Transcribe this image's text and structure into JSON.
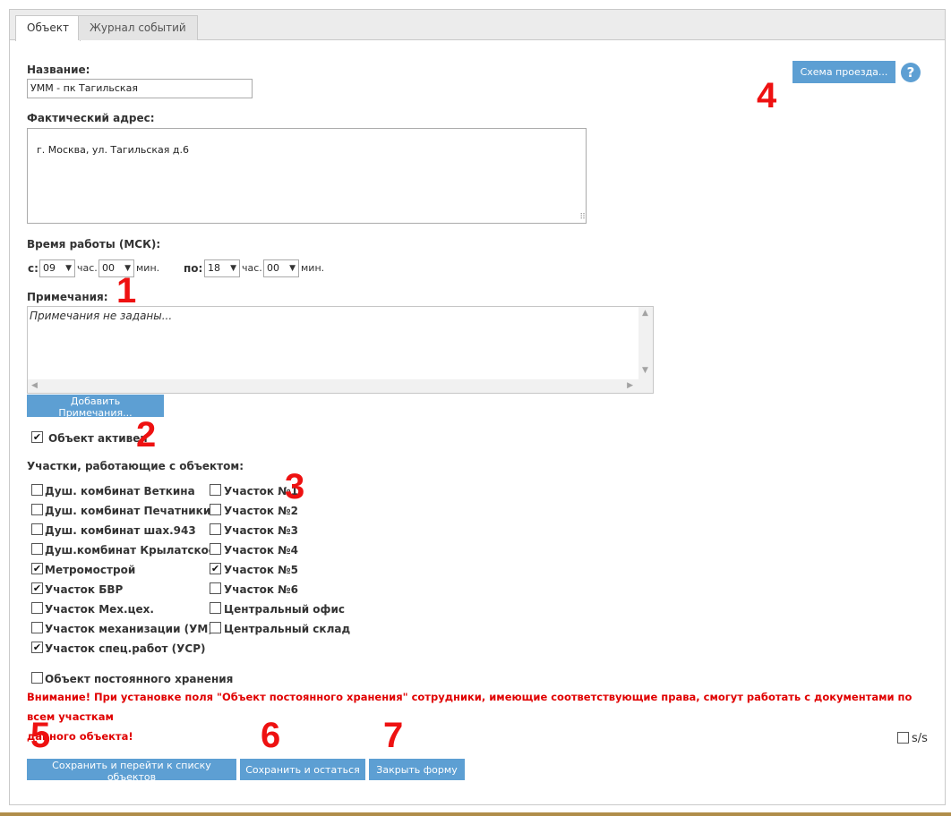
{
  "tabs": [
    {
      "label": "Объект",
      "active": true
    },
    {
      "label": "Журнал событий",
      "active": false
    }
  ],
  "form": {
    "name_label": "Название:",
    "name_value": "УММ - пк Тагильская",
    "address_label": "Фактический адрес:",
    "address_value": "г. Москва, ул. Тагильская д.6",
    "route_button": "Схема проезда...",
    "help_icon": "?",
    "work_time_label": "Время работы (МСК):",
    "from_label": "с:",
    "to_label": "по:",
    "from_hour": "09",
    "from_min": "00",
    "to_hour": "18",
    "to_min": "00",
    "hour_unit": "час.",
    "min_unit": "мин.",
    "notes_label": "Примечания:",
    "notes_placeholder": "Примечания не заданы...",
    "add_notes_button": "Добавить Примечания...",
    "active_label": "Объект активен",
    "active_checked": true,
    "sites_label": "Участки, работающие с объектом:",
    "sites_col1": [
      {
        "label": "Душ. комбинат Веткина",
        "checked": false
      },
      {
        "label": "Душ. комбинат Печатники",
        "checked": false
      },
      {
        "label": "Душ. комбинат шах.943",
        "checked": false
      },
      {
        "label": "Душ.комбинат Крылатское",
        "checked": false
      },
      {
        "label": "Метромострой",
        "checked": true
      },
      {
        "label": "Участок БВР",
        "checked": true
      },
      {
        "label": "Участок Мех.цех.",
        "checked": false
      },
      {
        "label": "Участок механизации (УМ)",
        "checked": false
      },
      {
        "label": "Участок спец.работ (УСР)",
        "checked": true
      }
    ],
    "sites_col2": [
      {
        "label": "Участок №1",
        "checked": false
      },
      {
        "label": "Участок №2",
        "checked": false
      },
      {
        "label": "Участок №3",
        "checked": false
      },
      {
        "label": "Участок №4",
        "checked": false
      },
      {
        "label": "Участок №5",
        "checked": true
      },
      {
        "label": "Участок №6",
        "checked": false
      },
      {
        "label": "Центральный офис",
        "checked": false
      },
      {
        "label": "Центральный склад",
        "checked": false
      }
    ],
    "permanent_label": "Объект постоянного хранения",
    "permanent_checked": false,
    "warning_line1": "Внимание! При установке поля \"Объект постоянного хранения\" сотрудники, имеющие соответствующие права, смогут работать с документами по всем участкам",
    "warning_line2": "данного объекта!",
    "ss_label": "s/s",
    "ss_checked": false,
    "save_list_button": "Сохранить и перейти к списку объектов",
    "save_stay_button": "Сохранить и остаться",
    "close_button": "Закрыть форму"
  },
  "markers": [
    "1",
    "2",
    "3",
    "4",
    "5",
    "6",
    "7"
  ],
  "colors": {
    "accent": "#5d9fd3",
    "warning": "#e00000",
    "marker": "#ee1111"
  }
}
